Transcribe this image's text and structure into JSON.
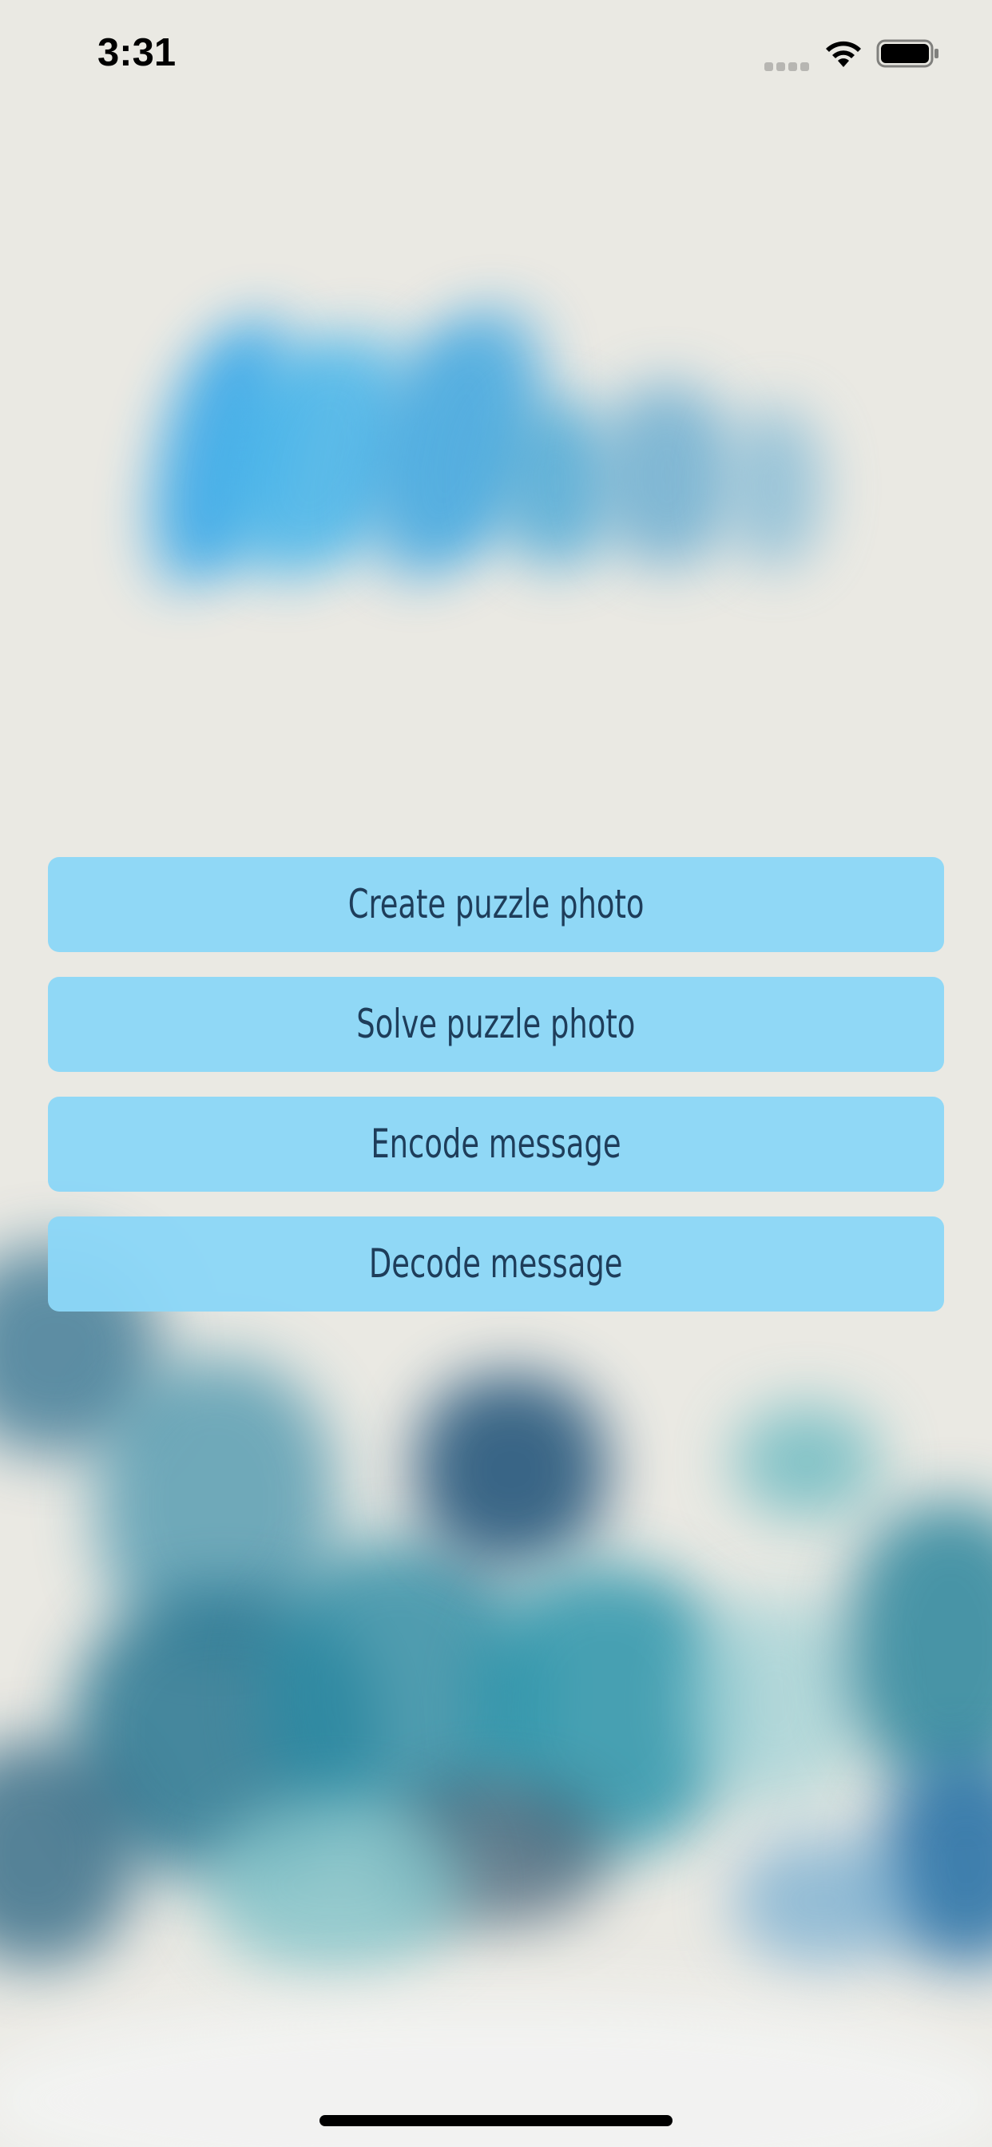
{
  "status_bar": {
    "time": "3:31"
  },
  "menu": {
    "buttons": [
      {
        "label": "Create puzzle photo"
      },
      {
        "label": "Solve puzzle photo"
      },
      {
        "label": "Encode message"
      },
      {
        "label": "Decode message"
      }
    ]
  },
  "icons": {
    "signal": "cellular-signal-icon",
    "wifi": "wifi-icon",
    "battery": "battery-icon"
  },
  "colors": {
    "background": "#eae9e3",
    "button_fill": "#8bd6f7",
    "button_text": "#1e3d5a",
    "logo_blue": "#3fa9e6"
  }
}
